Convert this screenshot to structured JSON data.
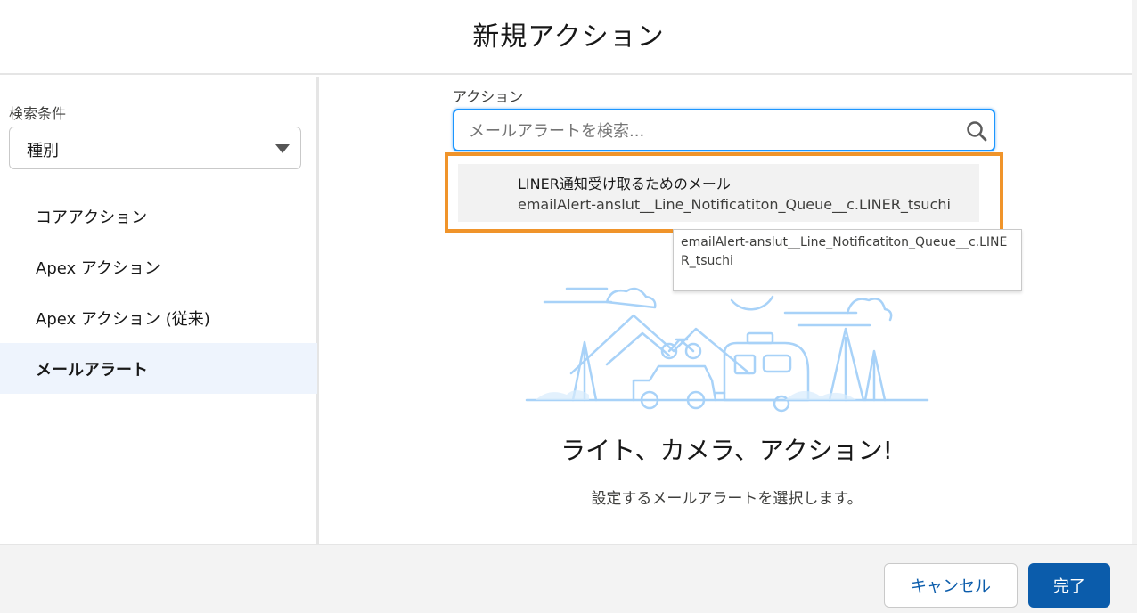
{
  "modal": {
    "title": "新規アクション"
  },
  "sidebar": {
    "filter_label": "検索条件",
    "filter_value": "種別",
    "items": [
      {
        "label": "コアアクション",
        "active": false
      },
      {
        "label": "Apex アクション",
        "active": false
      },
      {
        "label": "Apex アクション (従来)",
        "active": false
      },
      {
        "label": "メールアラート",
        "active": true
      }
    ]
  },
  "main": {
    "field_label": "アクション",
    "search": {
      "placeholder": "メールアラートを検索...",
      "value": "",
      "icon": "search-icon"
    },
    "result": {
      "title": "LINER通知受け取るためのメール",
      "subtitle": "emailAlert-anslut__Line_Notificatiton_Queue__c.LINER_tsuchi",
      "highlight_color": "#f0942a"
    },
    "tooltip": {
      "text": "emailAlert-anslut__Line_Notificatiton_Queue__c.LINER_tsuchi"
    },
    "empty_state": {
      "title": "ライト、カメラ、アクション!",
      "subtitle": "設定するメールアラートを選択します。"
    }
  },
  "footer": {
    "cancel_label": "キャンセル",
    "done_label": "完了"
  },
  "colors": {
    "brand": "#0b5cab",
    "focus": "#1b96ff",
    "active_nav_bg": "#eef4fd",
    "illustration": "#a8d2f8"
  }
}
